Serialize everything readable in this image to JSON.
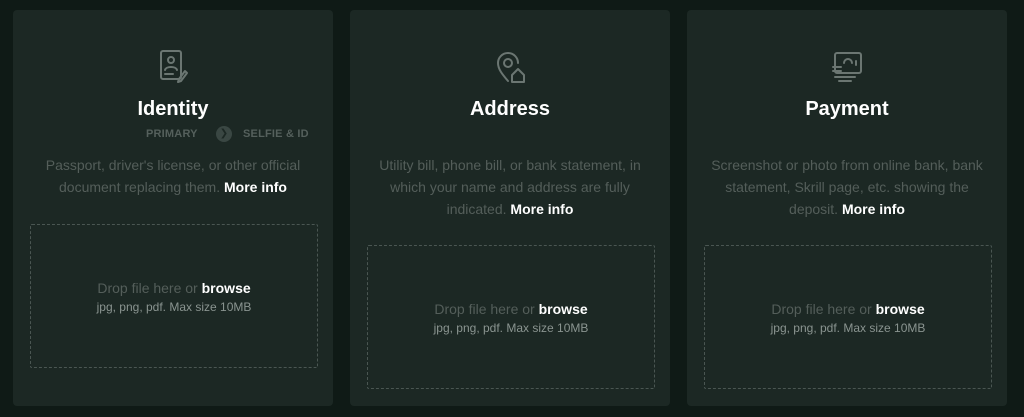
{
  "colors": {
    "background": "#0f1a16",
    "card": "#1c2824",
    "title": "#ffffff",
    "muted_text": "#545e5a",
    "accent_link": "#ffffff"
  },
  "cards": [
    {
      "icon": "id-card-icon",
      "title": "Identity",
      "steps": [
        "PRIMARY",
        "SELFIE & ID"
      ],
      "description": "Passport, driver's license, or other official document replacing them.",
      "more_info": "More info",
      "drop_text": "Drop file here or",
      "browse": "browse",
      "file_hint": "jpg, png, pdf. Max size 10MB"
    },
    {
      "icon": "location-home-icon",
      "title": "Address",
      "description": "Utility bill, phone bill, or bank statement, in which your name and address are fully indicated.",
      "more_info": "More info",
      "drop_text": "Drop file here or",
      "browse": "browse",
      "file_hint": "jpg, png, pdf. Max size 10MB"
    },
    {
      "icon": "payment-card-icon",
      "title": "Payment",
      "description": "Screenshot or photo from online bank, bank statement, Skrill page, etc. showing the deposit.",
      "more_info": "More info",
      "drop_text": "Drop file here or",
      "browse": "browse",
      "file_hint": "jpg, png, pdf. Max size 10MB"
    }
  ]
}
